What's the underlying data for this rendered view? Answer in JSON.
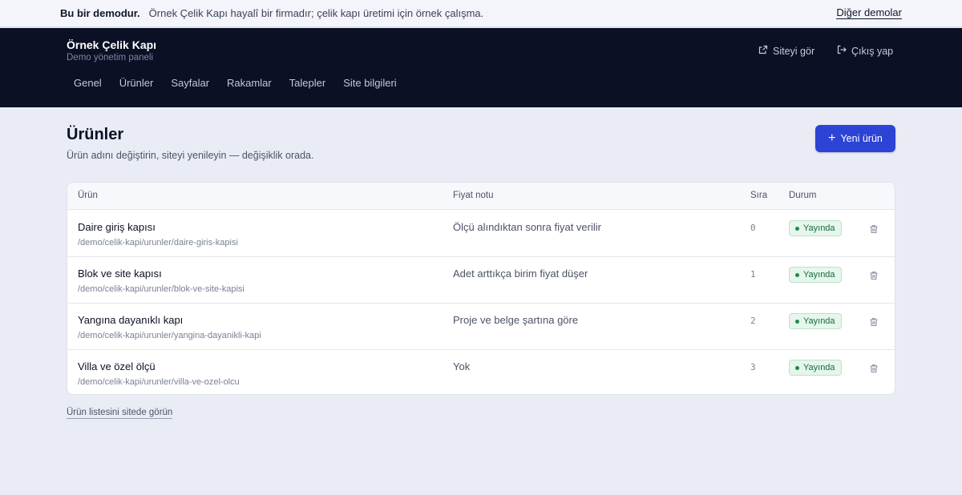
{
  "demo_bar": {
    "strong": "Bu bir demodur.",
    "description": "Örnek Çelik Kapı hayalî bir firmadır; çelik kapı üretimi için örnek çalışma.",
    "other_demos": "Diğer demolar"
  },
  "header": {
    "title": "Örnek Çelik Kapı",
    "subtitle": "Demo yönetim paneli",
    "view_site": "Siteyi gör",
    "logout": "Çıkış yap",
    "nav": [
      "Genel",
      "Ürünler",
      "Sayfalar",
      "Rakamlar",
      "Talepler",
      "Site bilgileri"
    ]
  },
  "page": {
    "title": "Ürünler",
    "subtitle": "Ürün adını değiştirin, siteyi yenileyin — değişiklik orada.",
    "new_button": "Yeni ürün"
  },
  "table": {
    "columns": {
      "product": "Ürün",
      "price_note": "Fiyat notu",
      "order": "Sıra",
      "status": "Durum"
    },
    "rows": [
      {
        "name": "Daire giriş kapısı",
        "path": "/demo/celik-kapi/urunler/daire-giris-kapisi",
        "note": "Ölçü alındıktan sonra fiyat verilir",
        "order": "0",
        "status": "Yayında"
      },
      {
        "name": "Blok ve site kapısı",
        "path": "/demo/celik-kapi/urunler/blok-ve-site-kapisi",
        "note": "Adet arttıkça birim fiyat düşer",
        "order": "1",
        "status": "Yayında"
      },
      {
        "name": "Yangına dayanıklı kapı",
        "path": "/demo/celik-kapi/urunler/yangina-dayanikli-kapi",
        "note": "Proje ve belge şartına göre",
        "order": "2",
        "status": "Yayında"
      },
      {
        "name": "Villa ve özel ölçü",
        "path": "/demo/celik-kapi/urunler/villa-ve-ozel-olcu",
        "note": "Yok",
        "order": "3",
        "status": "Yayında"
      }
    ]
  },
  "footer": {
    "link": "Ürün listesini sitede görün"
  },
  "colors": {
    "accent": "#2d43d6",
    "header_bg": "#0b1024",
    "status_green": "#1d8a4b"
  }
}
